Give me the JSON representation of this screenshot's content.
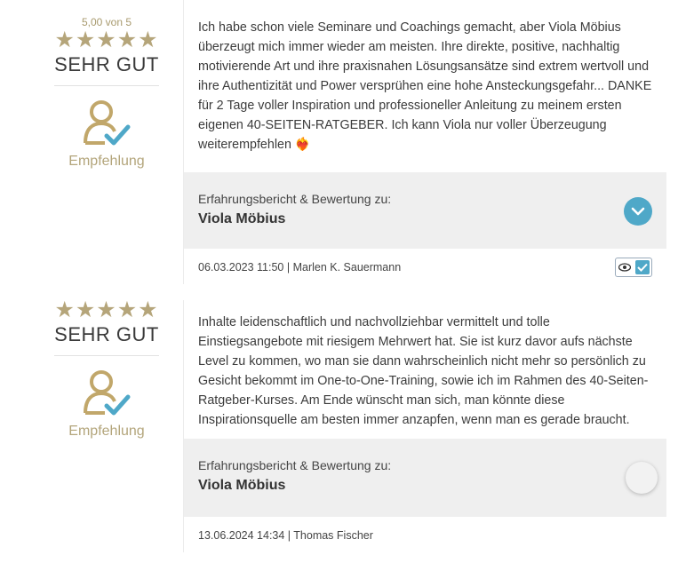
{
  "reviews": [
    {
      "score_text": "5,00 von 5",
      "stars": "★★★★★",
      "grade": "SEHR GUT",
      "recommendation_label": "Empfehlung",
      "text": "Ich habe schon viele Seminare und Coachings gemacht, aber Viola Möbius überzeugt mich immer wieder am meisten. Ihre direkte, positive, nachhaltig motivierende Art und ihre praxisnahen Lösungsansätze sind extrem wertvoll und ihre Authentizität und Power versprühen eine hohe Ansteckungsgefahr... DANKE für 2 Tage voller Inspiration und professioneller Anleitung zu meinem ersten eigenen 40-SEITEN-RATGEBER. Ich kann Viola nur voller Überzeugung weiterempfehlen ❤️‍🔥",
      "about_label": "Erfahrungsbericht & Bewertung zu:",
      "about_name": "Viola Möbius",
      "meta": "06.03.2023 11:50 | Marlen K. Sauermann",
      "expanded": true
    },
    {
      "stars": "★★★★★",
      "grade": "SEHR GUT",
      "recommendation_label": "Empfehlung",
      "text_partial_top": "Inhalte leidenschaftlich und nachvollziehbar vermittelt und tolle Einstiegsangebote mit riesigem Mehrwert hat. Sie ist kurz davor aufs nächste Level zu kommen, wo man sie dann wahrscheinlich nicht mehr so persönlich zu Gesicht bekommt im One-to-One-Training, sowie ich im Rahmen des 40-Seiten-Ratgeber-Kurses. Am Ende wünscht man sich, man könnte diese Inspirationsquelle am besten immer anzapfen, wenn man es gerade braucht.",
      "about_label": "Erfahrungsbericht & Bewertung zu:",
      "about_name": "Viola Möbius",
      "meta": "13.06.2024 14:34 | Thomas Fischer",
      "expanded": false
    }
  ],
  "colors": {
    "gold": "#b5a57a",
    "accent": "#4fa8c8",
    "panel": "#efefef"
  }
}
